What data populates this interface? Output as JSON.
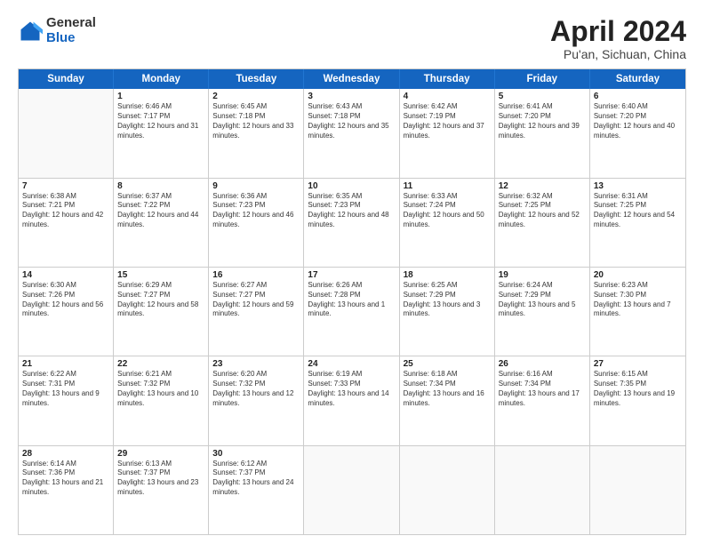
{
  "header": {
    "logo_general": "General",
    "logo_blue": "Blue",
    "month_title": "April 2024",
    "subtitle": "Pu'an, Sichuan, China"
  },
  "days": [
    "Sunday",
    "Monday",
    "Tuesday",
    "Wednesday",
    "Thursday",
    "Friday",
    "Saturday"
  ],
  "weeks": [
    [
      {
        "day": "",
        "empty": true
      },
      {
        "day": "1",
        "sunrise": "Sunrise: 6:46 AM",
        "sunset": "Sunset: 7:17 PM",
        "daylight": "Daylight: 12 hours and 31 minutes."
      },
      {
        "day": "2",
        "sunrise": "Sunrise: 6:45 AM",
        "sunset": "Sunset: 7:18 PM",
        "daylight": "Daylight: 12 hours and 33 minutes."
      },
      {
        "day": "3",
        "sunrise": "Sunrise: 6:43 AM",
        "sunset": "Sunset: 7:18 PM",
        "daylight": "Daylight: 12 hours and 35 minutes."
      },
      {
        "day": "4",
        "sunrise": "Sunrise: 6:42 AM",
        "sunset": "Sunset: 7:19 PM",
        "daylight": "Daylight: 12 hours and 37 minutes."
      },
      {
        "day": "5",
        "sunrise": "Sunrise: 6:41 AM",
        "sunset": "Sunset: 7:20 PM",
        "daylight": "Daylight: 12 hours and 39 minutes."
      },
      {
        "day": "6",
        "sunrise": "Sunrise: 6:40 AM",
        "sunset": "Sunset: 7:20 PM",
        "daylight": "Daylight: 12 hours and 40 minutes."
      }
    ],
    [
      {
        "day": "7",
        "sunrise": "Sunrise: 6:38 AM",
        "sunset": "Sunset: 7:21 PM",
        "daylight": "Daylight: 12 hours and 42 minutes."
      },
      {
        "day": "8",
        "sunrise": "Sunrise: 6:37 AM",
        "sunset": "Sunset: 7:22 PM",
        "daylight": "Daylight: 12 hours and 44 minutes."
      },
      {
        "day": "9",
        "sunrise": "Sunrise: 6:36 AM",
        "sunset": "Sunset: 7:23 PM",
        "daylight": "Daylight: 12 hours and 46 minutes."
      },
      {
        "day": "10",
        "sunrise": "Sunrise: 6:35 AM",
        "sunset": "Sunset: 7:23 PM",
        "daylight": "Daylight: 12 hours and 48 minutes."
      },
      {
        "day": "11",
        "sunrise": "Sunrise: 6:33 AM",
        "sunset": "Sunset: 7:24 PM",
        "daylight": "Daylight: 12 hours and 50 minutes."
      },
      {
        "day": "12",
        "sunrise": "Sunrise: 6:32 AM",
        "sunset": "Sunset: 7:25 PM",
        "daylight": "Daylight: 12 hours and 52 minutes."
      },
      {
        "day": "13",
        "sunrise": "Sunrise: 6:31 AM",
        "sunset": "Sunset: 7:25 PM",
        "daylight": "Daylight: 12 hours and 54 minutes."
      }
    ],
    [
      {
        "day": "14",
        "sunrise": "Sunrise: 6:30 AM",
        "sunset": "Sunset: 7:26 PM",
        "daylight": "Daylight: 12 hours and 56 minutes."
      },
      {
        "day": "15",
        "sunrise": "Sunrise: 6:29 AM",
        "sunset": "Sunset: 7:27 PM",
        "daylight": "Daylight: 12 hours and 58 minutes."
      },
      {
        "day": "16",
        "sunrise": "Sunrise: 6:27 AM",
        "sunset": "Sunset: 7:27 PM",
        "daylight": "Daylight: 12 hours and 59 minutes."
      },
      {
        "day": "17",
        "sunrise": "Sunrise: 6:26 AM",
        "sunset": "Sunset: 7:28 PM",
        "daylight": "Daylight: 13 hours and 1 minute."
      },
      {
        "day": "18",
        "sunrise": "Sunrise: 6:25 AM",
        "sunset": "Sunset: 7:29 PM",
        "daylight": "Daylight: 13 hours and 3 minutes."
      },
      {
        "day": "19",
        "sunrise": "Sunrise: 6:24 AM",
        "sunset": "Sunset: 7:29 PM",
        "daylight": "Daylight: 13 hours and 5 minutes."
      },
      {
        "day": "20",
        "sunrise": "Sunrise: 6:23 AM",
        "sunset": "Sunset: 7:30 PM",
        "daylight": "Daylight: 13 hours and 7 minutes."
      }
    ],
    [
      {
        "day": "21",
        "sunrise": "Sunrise: 6:22 AM",
        "sunset": "Sunset: 7:31 PM",
        "daylight": "Daylight: 13 hours and 9 minutes."
      },
      {
        "day": "22",
        "sunrise": "Sunrise: 6:21 AM",
        "sunset": "Sunset: 7:32 PM",
        "daylight": "Daylight: 13 hours and 10 minutes."
      },
      {
        "day": "23",
        "sunrise": "Sunrise: 6:20 AM",
        "sunset": "Sunset: 7:32 PM",
        "daylight": "Daylight: 13 hours and 12 minutes."
      },
      {
        "day": "24",
        "sunrise": "Sunrise: 6:19 AM",
        "sunset": "Sunset: 7:33 PM",
        "daylight": "Daylight: 13 hours and 14 minutes."
      },
      {
        "day": "25",
        "sunrise": "Sunrise: 6:18 AM",
        "sunset": "Sunset: 7:34 PM",
        "daylight": "Daylight: 13 hours and 16 minutes."
      },
      {
        "day": "26",
        "sunrise": "Sunrise: 6:16 AM",
        "sunset": "Sunset: 7:34 PM",
        "daylight": "Daylight: 13 hours and 17 minutes."
      },
      {
        "day": "27",
        "sunrise": "Sunrise: 6:15 AM",
        "sunset": "Sunset: 7:35 PM",
        "daylight": "Daylight: 13 hours and 19 minutes."
      }
    ],
    [
      {
        "day": "28",
        "sunrise": "Sunrise: 6:14 AM",
        "sunset": "Sunset: 7:36 PM",
        "daylight": "Daylight: 13 hours and 21 minutes."
      },
      {
        "day": "29",
        "sunrise": "Sunrise: 6:13 AM",
        "sunset": "Sunset: 7:37 PM",
        "daylight": "Daylight: 13 hours and 23 minutes."
      },
      {
        "day": "30",
        "sunrise": "Sunrise: 6:12 AM",
        "sunset": "Sunset: 7:37 PM",
        "daylight": "Daylight: 13 hours and 24 minutes."
      },
      {
        "day": "",
        "empty": true
      },
      {
        "day": "",
        "empty": true
      },
      {
        "day": "",
        "empty": true
      },
      {
        "day": "",
        "empty": true
      }
    ]
  ]
}
